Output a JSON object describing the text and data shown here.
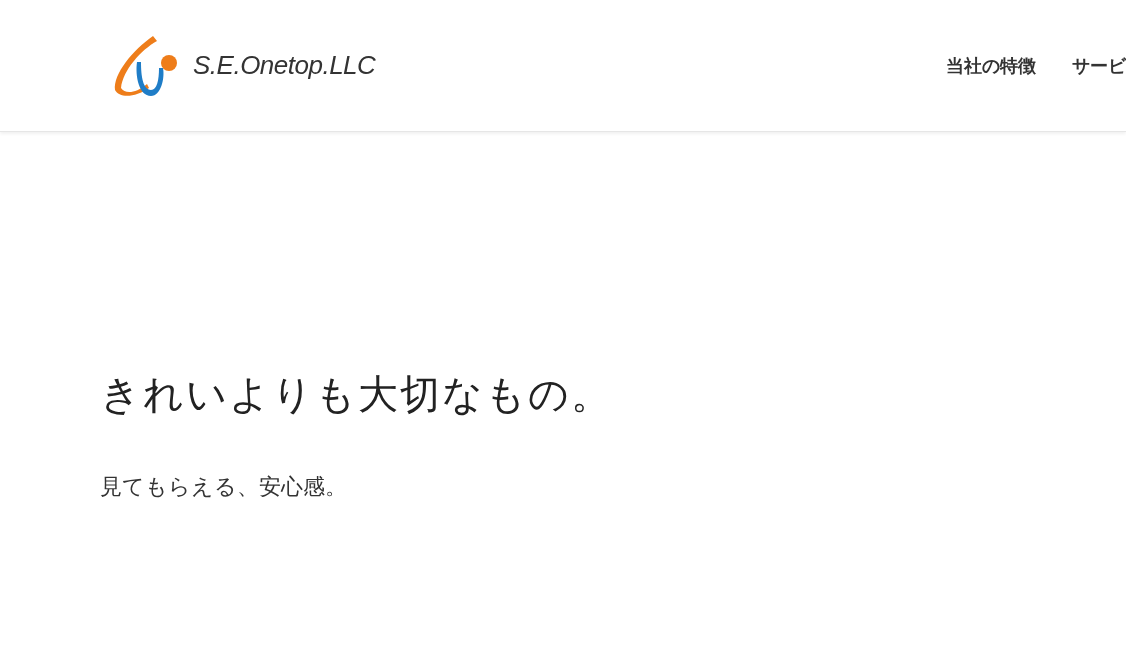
{
  "header": {
    "logo_text": "S.E.Onetop.LLC",
    "nav": [
      {
        "label": "当社の特徴"
      },
      {
        "label": "サービ"
      }
    ]
  },
  "hero": {
    "title": "きれいよりも大切なもの。",
    "subtitle": "見てもらえる、安心感。"
  }
}
